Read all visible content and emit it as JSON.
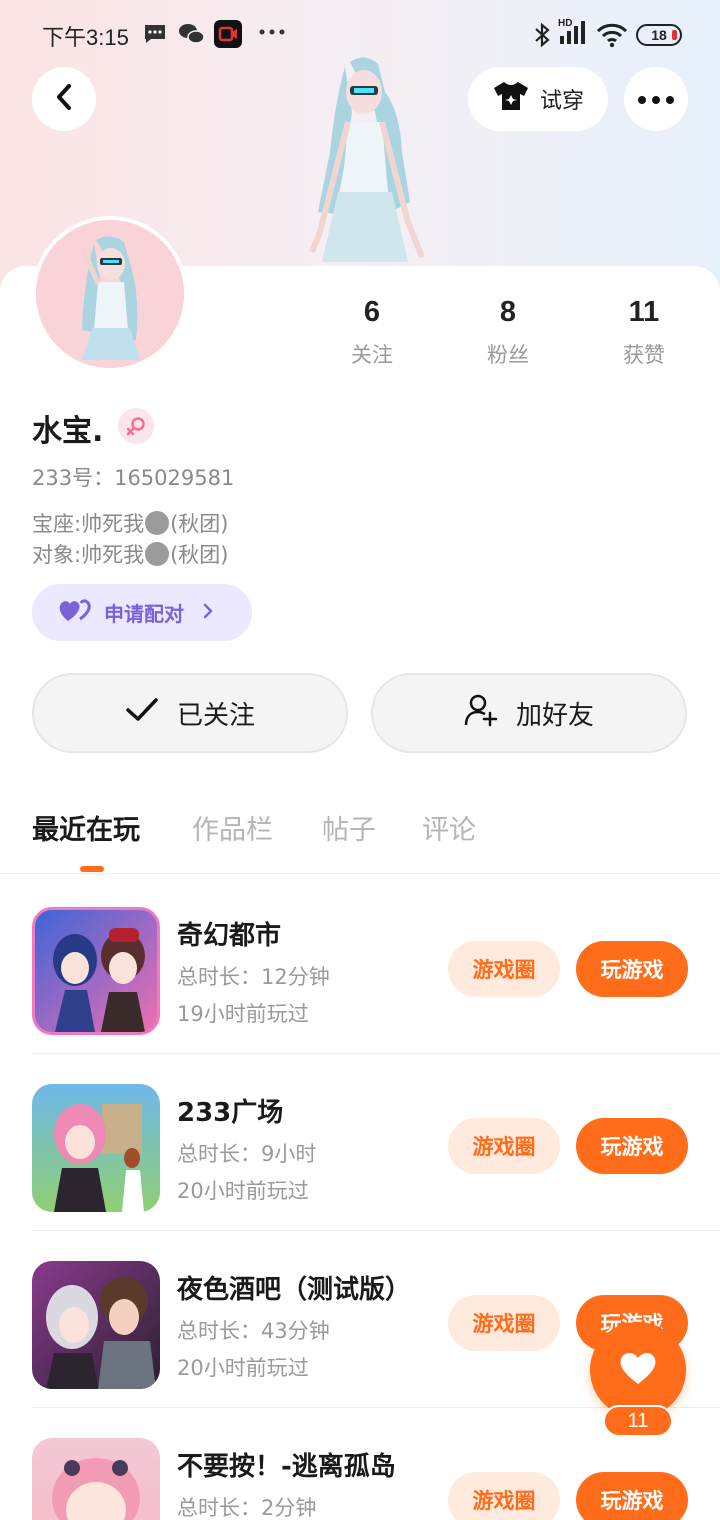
{
  "status_bar": {
    "time": "下午3:15",
    "network_label": "HD",
    "battery": "18",
    "icons": [
      "message-icon",
      "wechat-icon",
      "recorder-icon",
      "more-dots-icon",
      "bluetooth-icon",
      "signal-icon",
      "wifi-icon",
      "battery-icon"
    ]
  },
  "header": {
    "back_icon": "chevron-left-icon",
    "tryon_label": "试穿",
    "tryon_icon": "tshirt-icon",
    "more_icon": "more-horizontal-icon"
  },
  "profile": {
    "name": "水宝.",
    "gender": "female",
    "account_id": "233号：165029581",
    "signature_line1_prefix": "宝座:帅死我",
    "signature_line1_suffix": "(秋团)",
    "signature_line2_prefix": "对象:帅死我",
    "signature_line2_suffix": "(秋团)",
    "pair_label": "申请配对"
  },
  "stats": [
    {
      "value": "6",
      "label": "关注"
    },
    {
      "value": "8",
      "label": "粉丝"
    },
    {
      "value": "11",
      "label": "获赞"
    }
  ],
  "actions": {
    "followed_label": "已关注",
    "add_friend_label": "加好友"
  },
  "tabs": [
    {
      "label": "最近在玩",
      "active": true
    },
    {
      "label": "作品栏",
      "active": false
    },
    {
      "label": "帖子",
      "active": false
    },
    {
      "label": "评论",
      "active": false
    }
  ],
  "games": [
    {
      "title": "奇幻都市",
      "duration": "总时长：12分钟",
      "last_played": "19小时前玩过",
      "circle_label": "游戏圈",
      "play_label": "玩游戏"
    },
    {
      "title": "233广场",
      "duration": "总时长：9小时",
      "last_played": "20小时前玩过",
      "circle_label": "游戏圈",
      "play_label": "玩游戏"
    },
    {
      "title": "夜色酒吧（测试版）",
      "duration": "总时长：43分钟",
      "last_played": "20小时前玩过",
      "circle_label": "游戏圈",
      "play_label": "玩游戏"
    },
    {
      "title": "不要按！-逃离孤岛",
      "duration": "总时长：2分钟",
      "last_played": "",
      "circle_label": "游戏圈",
      "play_label": "玩游戏"
    }
  ],
  "like_fab": {
    "count": "11"
  },
  "colors": {
    "accent": "#ff6d1a",
    "accent_light": "#ffeadd",
    "pair_bg": "#ece8ff",
    "pair_text": "#7a63d9"
  }
}
